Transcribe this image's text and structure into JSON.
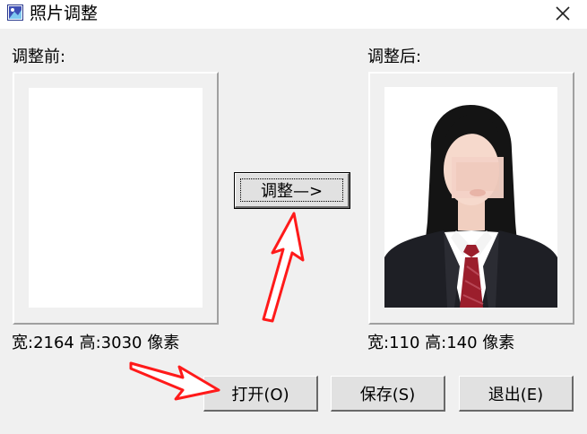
{
  "window": {
    "title": "照片调整",
    "close_symbol": "✕",
    "icon": "photo-adjust-app-icon"
  },
  "before": {
    "label": "调整前:",
    "dimensions": "宽:2164 高:3030 像素"
  },
  "after": {
    "label": "调整后:",
    "dimensions": "宽:110 高:140 像素"
  },
  "buttons": {
    "adjust": "调整—>",
    "open": "打开(O)",
    "save": "保存(S)",
    "exit": "退出(E)"
  },
  "colors": {
    "annotation_arrow": "#ff1a1a",
    "window_background": "#f0f0f0",
    "button_face": "#e1e1e1",
    "suit": "#1e1f25",
    "tie": "#9b1e2c"
  },
  "annotations": [
    "red-arrow-to-adjust-button",
    "red-arrow-to-open-button"
  ]
}
